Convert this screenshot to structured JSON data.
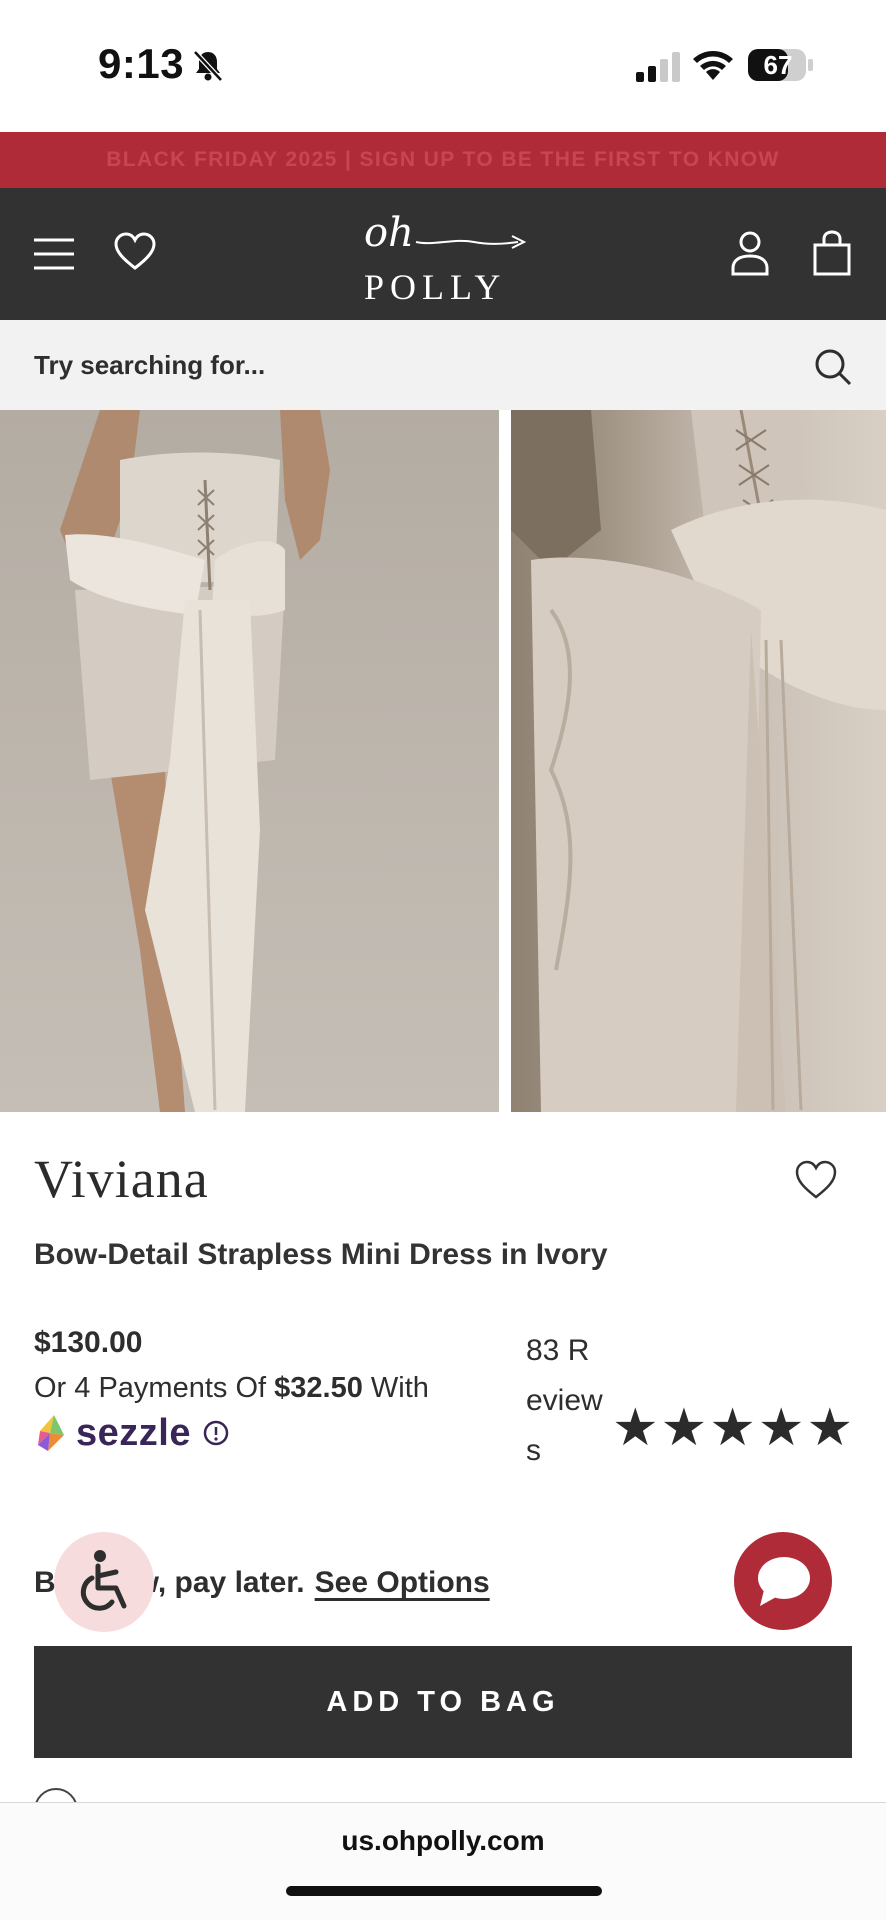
{
  "status_bar": {
    "time": "9:13",
    "battery_level": "67"
  },
  "promo_banner": {
    "text": "BLACK FRIDAY 2025 | SIGN UP TO BE THE FIRST TO KNOW"
  },
  "header": {
    "logo_script": "oh",
    "logo_word": "POLLY",
    "icons": [
      "menu-icon",
      "heart-icon",
      "account-icon",
      "bag-icon"
    ]
  },
  "search": {
    "placeholder": "Try searching for..."
  },
  "product": {
    "brand": "Viviana",
    "name": "Bow-Detail Strapless Mini Dress in Ivory",
    "price": "$130.00",
    "installments_prefix": "Or 4 Payments Of ",
    "installment_amount": "$32.50",
    "installments_suffix": " With",
    "payment_provider": "sezzle",
    "reviews_label": "83 Reviews",
    "rating": 5,
    "stars": "★★★★★"
  },
  "bnpl": {
    "text": "Buy now, pay later.",
    "link_label": "See Options"
  },
  "actions": {
    "add_to_bag": "ADD TO BAG"
  },
  "browser": {
    "url": "us.ohpolly.com"
  },
  "colors": {
    "brand_red": "#b02b38",
    "header_dark": "#323232",
    "search_bg": "#f2f2f2",
    "sezzle_purple": "#392558"
  }
}
